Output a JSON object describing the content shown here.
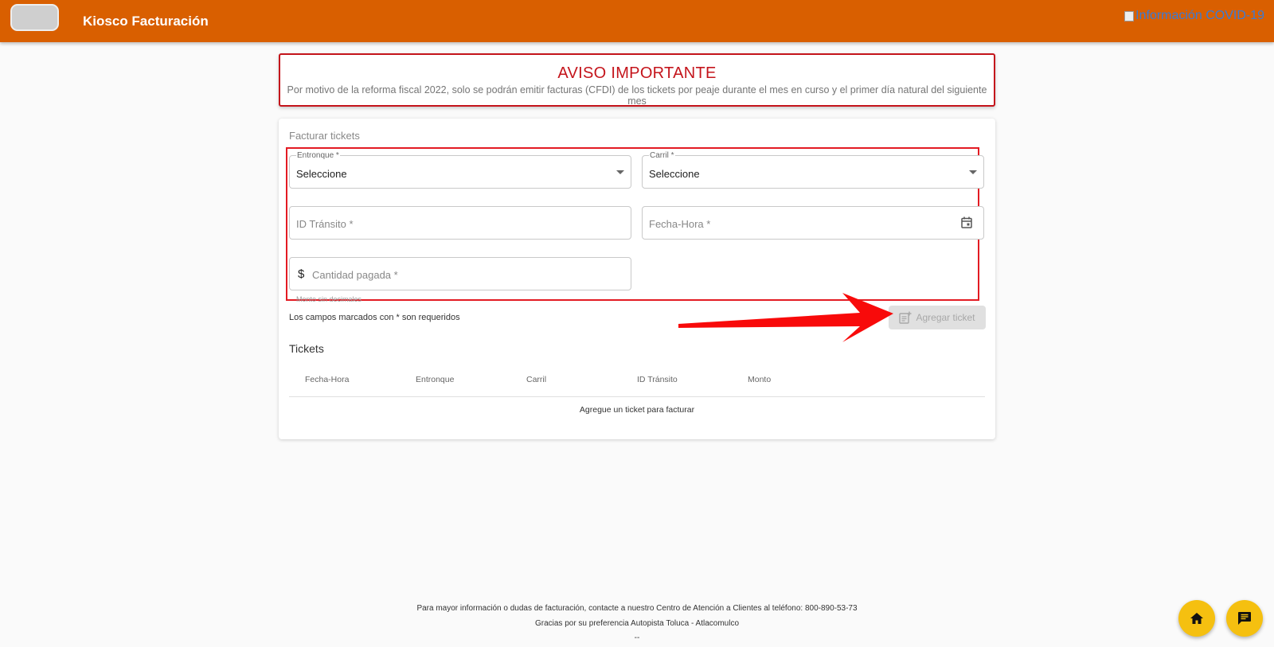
{
  "header": {
    "title": "Kiosco Facturación",
    "covid_link": "Información COVID-19",
    "brand_color": "#d95f00"
  },
  "notice": {
    "title": "AVISO IMPORTANTE",
    "text": "Por motivo de la reforma fiscal 2022, solo se podrán emitir facturas (CFDI) de los tickets por peaje durante el mes en curso y el primer día natural del siguiente mes"
  },
  "form": {
    "title": "Facturar tickets",
    "entronque": {
      "label": "Entronque *",
      "value": "Seleccione"
    },
    "carril": {
      "label": "Carril *",
      "value": "Seleccione"
    },
    "id_transito": {
      "placeholder": "ID Tránsito *"
    },
    "fecha_hora": {
      "placeholder": "Fecha-Hora *"
    },
    "cantidad": {
      "placeholder": "Cantidad pagada *",
      "prefix": "$",
      "hint": "Monto sin decimales"
    },
    "required_note": "Los campos marcados con * son requeridos",
    "add_button": "Agregar ticket"
  },
  "tickets": {
    "title": "Tickets",
    "columns": [
      "Fecha-Hora",
      "Entronque",
      "Carril",
      "ID Tránsito",
      "Monto"
    ],
    "empty_message": "Agregue un ticket para facturar"
  },
  "footer": {
    "line1": "Para mayor información o dudas de facturación, contacte a nuestro Centro de Atención a Clientes al teléfono: 800-890-53-73",
    "line2": "Gracias por su preferencia Autopista Toluca - Atlacomulco",
    "line3": "--"
  },
  "icons": {
    "home": "home-icon",
    "chat": "chat-icon",
    "calendar": "calendar-icon",
    "add_note": "note-add-icon"
  },
  "annotation_color": "#e31b23",
  "fab_color": "#f5c010"
}
